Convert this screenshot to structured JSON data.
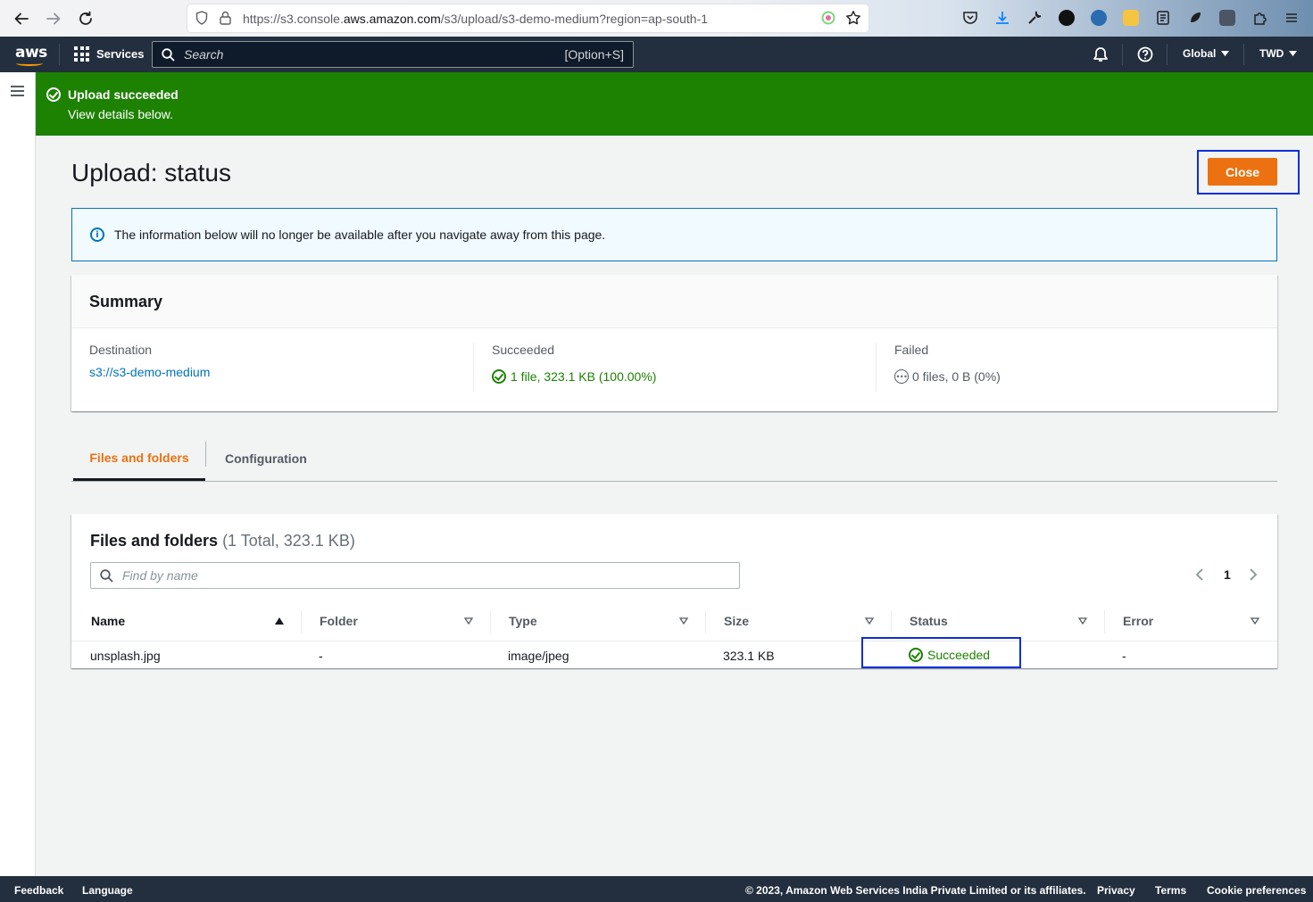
{
  "browser": {
    "url_prefix": "https://s3.console.",
    "url_domain": "aws.amazon.com",
    "url_path": "/s3/upload/s3-demo-medium?region=ap-south-1"
  },
  "aws_nav": {
    "logo": "aws",
    "services_label": "Services",
    "search_placeholder": "Search",
    "search_shortcut": "[Option+S]",
    "region": "Global",
    "account": "TWD"
  },
  "flash": {
    "title": "Upload succeeded",
    "message": "View details below."
  },
  "page": {
    "title": "Upload: status",
    "close_label": "Close"
  },
  "info_alert": {
    "icon": "i",
    "text": "The information below will no longer be available after you navigate away from this page."
  },
  "summary": {
    "title": "Summary",
    "destination_label": "Destination",
    "destination_value": "s3://s3-demo-medium",
    "succeeded_label": "Succeeded",
    "succeeded_value": "1 file, 323.1 KB (100.00%)",
    "failed_label": "Failed",
    "failed_icon": "•••",
    "failed_value": "0 files, 0 B (0%)"
  },
  "tabs": [
    {
      "label": "Files and folders",
      "active": true
    },
    {
      "label": "Configuration",
      "active": false
    }
  ],
  "files": {
    "title": "Files and folders",
    "count": "(1 Total, 323.1 KB)",
    "find_placeholder": "Find by name",
    "page_number": "1",
    "columns": [
      "Name",
      "Folder",
      "Type",
      "Size",
      "Status",
      "Error"
    ],
    "rows": [
      {
        "name": "unsplash.jpg",
        "folder": "-",
        "type": "image/jpeg",
        "size": "323.1 KB",
        "status": "Succeeded",
        "error": "-"
      }
    ]
  },
  "footer": {
    "feedback": "Feedback",
    "language": "Language",
    "copyright": "© 2023, Amazon Web Services India Private Limited or its affiliates.",
    "privacy": "Privacy",
    "terms": "Terms",
    "cookies": "Cookie preferences"
  },
  "colors": {
    "aws_nav": "#232f3e",
    "flash_success": "#1d8102",
    "primary_button": "#ec7211",
    "link": "#0073bb",
    "focus_outline": "#0b2edb"
  }
}
